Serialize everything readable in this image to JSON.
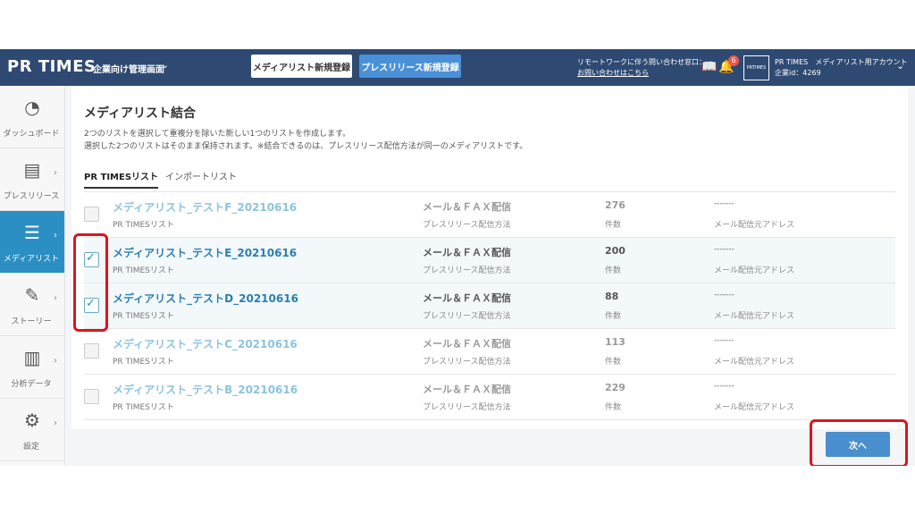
{
  "header": {
    "logo": "PR TIMES",
    "mode": "企業向け管理画面",
    "media_register_button": "メディアリスト新規登録",
    "press_register_button": "プレスリリース新規登録",
    "remote_notice": "リモートワークに伴う問い合わせ窓口：",
    "remote_link": "お問い合わせはこちら",
    "notification_count": "6",
    "company_logo_text": "PRTIMES",
    "account_name": "PR TIMES　メディアリスト用アカウント",
    "company_id": "企業id：4269"
  },
  "sidebar": {
    "items": [
      {
        "label": "ダッシュボード",
        "icon": "dashboard-icon"
      },
      {
        "label": "プレスリリース",
        "icon": "press-release-icon"
      },
      {
        "label": "メディアリスト",
        "icon": "media-list-icon"
      },
      {
        "label": "ストーリー",
        "icon": "story-icon"
      },
      {
        "label": "分析データ",
        "icon": "analytics-icon"
      },
      {
        "label": "設定",
        "icon": "gear-icon"
      }
    ]
  },
  "main": {
    "title": "メディアリスト結合",
    "description_line1": "2つのリストを選択して重複分を除いた新しい1つのリストを作成します。",
    "description_line2": "選択した2つのリストはそのまま保持されます。※結合できるのは、プレスリリース配信方法が同一のメディアリストです。",
    "tabs": [
      {
        "label": "PR TIMESリスト"
      },
      {
        "label": "インポートリスト"
      }
    ],
    "rows": [
      {
        "name": "メディアリスト_テストF_20210616",
        "sub": "PR TIMESリスト",
        "method": "メール＆ＦＡＸ配信",
        "method_label": "プレスリリース配信方法",
        "count": "276",
        "count_label": "件数",
        "address": "-------",
        "address_label": "メール配信元アドレス",
        "checked": false
      },
      {
        "name": "メディアリスト_テストE_20210616",
        "sub": "PR TIMESリスト",
        "method": "メール＆ＦＡＸ配信",
        "method_label": "プレスリリース配信方法",
        "count": "200",
        "count_label": "件数",
        "address": "-------",
        "address_label": "メール配信元アドレス",
        "checked": true
      },
      {
        "name": "メディアリスト_テストD_20210616",
        "sub": "PR TIMESリスト",
        "method": "メール＆ＦＡＸ配信",
        "method_label": "プレスリリース配信方法",
        "count": "88",
        "count_label": "件数",
        "address": "-------",
        "address_label": "メール配信元アドレス",
        "checked": true
      },
      {
        "name": "メディアリスト_テストC_20210616",
        "sub": "PR TIMESリスト",
        "method": "メール＆ＦＡＸ配信",
        "method_label": "プレスリリース配信方法",
        "count": "113",
        "count_label": "件数",
        "address": "-------",
        "address_label": "メール配信元アドレス",
        "checked": false
      },
      {
        "name": "メディアリスト_テストB_20210616",
        "sub": "PR TIMESリスト",
        "method": "メール＆ＦＡＸ配信",
        "method_label": "プレスリリース配信方法",
        "count": "229",
        "count_label": "件数",
        "address": "-------",
        "address_label": "メール配信元アドレス",
        "checked": false
      }
    ],
    "next_button": "次へ"
  },
  "colors": {
    "header_bg": "#2e4a72",
    "active_nav": "#2b8fc3",
    "link": "#3aa0cc",
    "primary_button": "#4a8fcd",
    "highlight": "#d9161e"
  }
}
